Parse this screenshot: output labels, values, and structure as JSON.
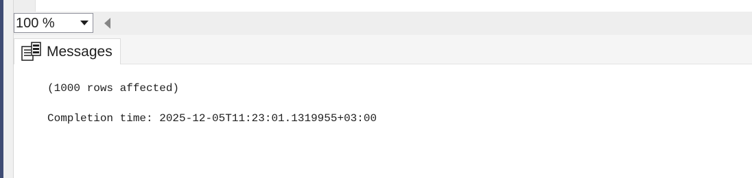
{
  "zoom": {
    "value": "100 %",
    "dropdown_icon": "chevron-down-icon",
    "scroll_icon": "scroll-left-arrow-icon"
  },
  "tabs": [
    {
      "label": "Messages",
      "icon": "messages-icon",
      "active": true
    }
  ],
  "messages": {
    "lines": [
      "(1000 rows affected)",
      "Completion time: 2025-12-05T11:23:01.1319955+03:00"
    ]
  },
  "colors": {
    "left_accent": "#3f4c74",
    "toolbar_bg": "#eeeeee",
    "text": "#1e1e1e"
  }
}
